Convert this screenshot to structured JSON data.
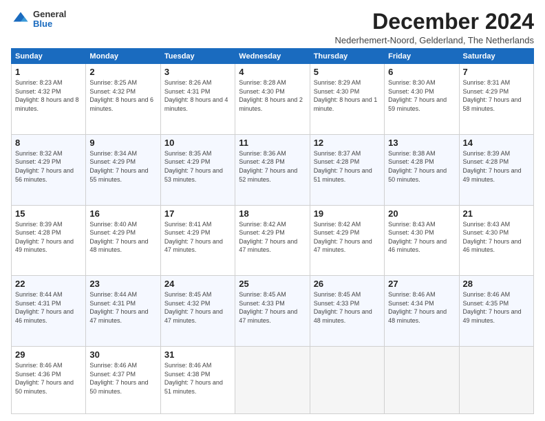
{
  "logo": {
    "general": "General",
    "blue": "Blue"
  },
  "title": "December 2024",
  "location": "Nederhemert-Noord, Gelderland, The Netherlands",
  "days_of_week": [
    "Sunday",
    "Monday",
    "Tuesday",
    "Wednesday",
    "Thursday",
    "Friday",
    "Saturday"
  ],
  "weeks": [
    [
      {
        "day": "1",
        "sunrise": "8:23 AM",
        "sunset": "4:32 PM",
        "daylight": "8 hours and 8 minutes."
      },
      {
        "day": "2",
        "sunrise": "8:25 AM",
        "sunset": "4:32 PM",
        "daylight": "8 hours and 6 minutes."
      },
      {
        "day": "3",
        "sunrise": "8:26 AM",
        "sunset": "4:31 PM",
        "daylight": "8 hours and 4 minutes."
      },
      {
        "day": "4",
        "sunrise": "8:28 AM",
        "sunset": "4:30 PM",
        "daylight": "8 hours and 2 minutes."
      },
      {
        "day": "5",
        "sunrise": "8:29 AM",
        "sunset": "4:30 PM",
        "daylight": "8 hours and 1 minute."
      },
      {
        "day": "6",
        "sunrise": "8:30 AM",
        "sunset": "4:30 PM",
        "daylight": "7 hours and 59 minutes."
      },
      {
        "day": "7",
        "sunrise": "8:31 AM",
        "sunset": "4:29 PM",
        "daylight": "7 hours and 58 minutes."
      }
    ],
    [
      {
        "day": "8",
        "sunrise": "8:32 AM",
        "sunset": "4:29 PM",
        "daylight": "7 hours and 56 minutes."
      },
      {
        "day": "9",
        "sunrise": "8:34 AM",
        "sunset": "4:29 PM",
        "daylight": "7 hours and 55 minutes."
      },
      {
        "day": "10",
        "sunrise": "8:35 AM",
        "sunset": "4:29 PM",
        "daylight": "7 hours and 53 minutes."
      },
      {
        "day": "11",
        "sunrise": "8:36 AM",
        "sunset": "4:28 PM",
        "daylight": "7 hours and 52 minutes."
      },
      {
        "day": "12",
        "sunrise": "8:37 AM",
        "sunset": "4:28 PM",
        "daylight": "7 hours and 51 minutes."
      },
      {
        "day": "13",
        "sunrise": "8:38 AM",
        "sunset": "4:28 PM",
        "daylight": "7 hours and 50 minutes."
      },
      {
        "day": "14",
        "sunrise": "8:39 AM",
        "sunset": "4:28 PM",
        "daylight": "7 hours and 49 minutes."
      }
    ],
    [
      {
        "day": "15",
        "sunrise": "8:39 AM",
        "sunset": "4:28 PM",
        "daylight": "7 hours and 49 minutes."
      },
      {
        "day": "16",
        "sunrise": "8:40 AM",
        "sunset": "4:29 PM",
        "daylight": "7 hours and 48 minutes."
      },
      {
        "day": "17",
        "sunrise": "8:41 AM",
        "sunset": "4:29 PM",
        "daylight": "7 hours and 47 minutes."
      },
      {
        "day": "18",
        "sunrise": "8:42 AM",
        "sunset": "4:29 PM",
        "daylight": "7 hours and 47 minutes."
      },
      {
        "day": "19",
        "sunrise": "8:42 AM",
        "sunset": "4:29 PM",
        "daylight": "7 hours and 47 minutes."
      },
      {
        "day": "20",
        "sunrise": "8:43 AM",
        "sunset": "4:30 PM",
        "daylight": "7 hours and 46 minutes."
      },
      {
        "day": "21",
        "sunrise": "8:43 AM",
        "sunset": "4:30 PM",
        "daylight": "7 hours and 46 minutes."
      }
    ],
    [
      {
        "day": "22",
        "sunrise": "8:44 AM",
        "sunset": "4:31 PM",
        "daylight": "7 hours and 46 minutes."
      },
      {
        "day": "23",
        "sunrise": "8:44 AM",
        "sunset": "4:31 PM",
        "daylight": "7 hours and 47 minutes."
      },
      {
        "day": "24",
        "sunrise": "8:45 AM",
        "sunset": "4:32 PM",
        "daylight": "7 hours and 47 minutes."
      },
      {
        "day": "25",
        "sunrise": "8:45 AM",
        "sunset": "4:33 PM",
        "daylight": "7 hours and 47 minutes."
      },
      {
        "day": "26",
        "sunrise": "8:45 AM",
        "sunset": "4:33 PM",
        "daylight": "7 hours and 48 minutes."
      },
      {
        "day": "27",
        "sunrise": "8:46 AM",
        "sunset": "4:34 PM",
        "daylight": "7 hours and 48 minutes."
      },
      {
        "day": "28",
        "sunrise": "8:46 AM",
        "sunset": "4:35 PM",
        "daylight": "7 hours and 49 minutes."
      }
    ],
    [
      {
        "day": "29",
        "sunrise": "8:46 AM",
        "sunset": "4:36 PM",
        "daylight": "7 hours and 50 minutes."
      },
      {
        "day": "30",
        "sunrise": "8:46 AM",
        "sunset": "4:37 PM",
        "daylight": "7 hours and 50 minutes."
      },
      {
        "day": "31",
        "sunrise": "8:46 AM",
        "sunset": "4:38 PM",
        "daylight": "7 hours and 51 minutes."
      },
      null,
      null,
      null,
      null
    ]
  ]
}
